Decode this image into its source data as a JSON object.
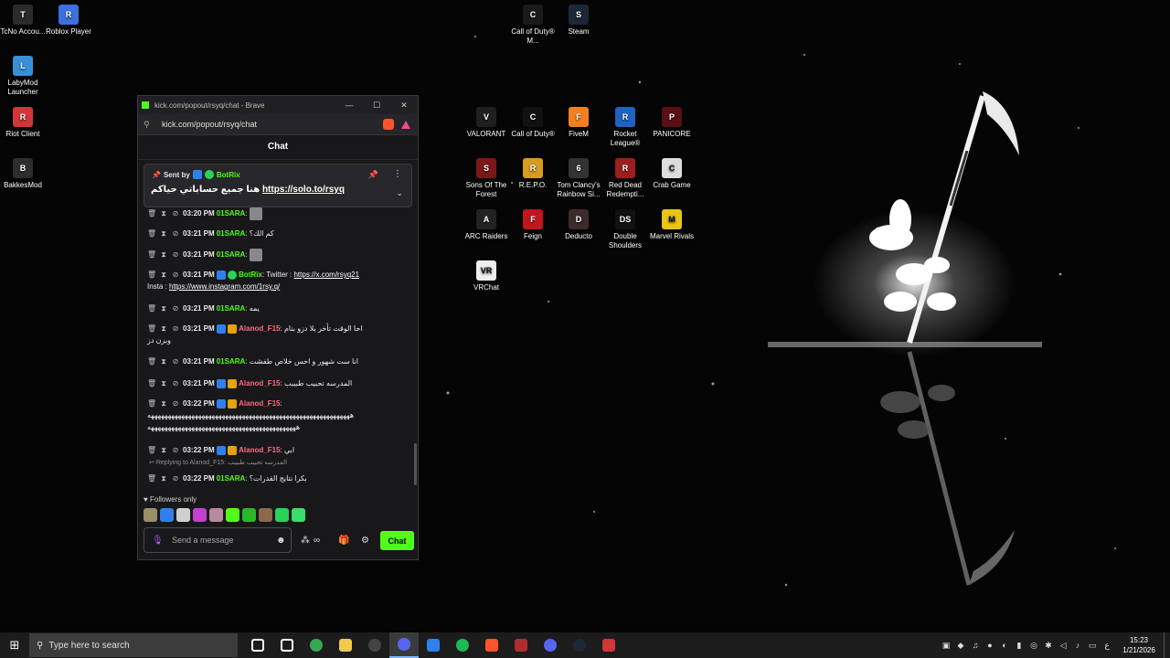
{
  "desktop_icons": [
    {
      "label": "TcNo Accou...",
      "color": "#2b2b2b",
      "glyph": "T"
    },
    {
      "label": "Roblox Player",
      "color": "#3c6fe0",
      "glyph": "R"
    },
    {
      "label": "LabyMod Launcher",
      "color": "#3a8fd9",
      "glyph": "L"
    },
    {
      "label": "Riot Client",
      "color": "#d13639",
      "glyph": "R"
    },
    {
      "label": "BakkesMod",
      "color": "#2d2d2d",
      "glyph": "B"
    },
    {
      "label": "Call of Duty® M...",
      "color": "#1a1a1a",
      "glyph": "C"
    },
    {
      "label": "Steam",
      "color": "#1b2838",
      "glyph": "S"
    },
    {
      "label": "VALORANT",
      "color": "#1f1f1f",
      "glyph": "V"
    },
    {
      "label": "Call of Duty®",
      "color": "#111",
      "glyph": "C"
    },
    {
      "label": "FiveM",
      "color": "#f37f20",
      "glyph": "F"
    },
    {
      "label": "Rocket League®",
      "color": "#1e62c4",
      "glyph": "R"
    },
    {
      "label": "PANICORE",
      "color": "#5a0f14",
      "glyph": "P"
    },
    {
      "label": "Sons Of The Forest",
      "color": "#7a1818",
      "glyph": "S"
    },
    {
      "label": "R.E.P.O.",
      "color": "#d69c20",
      "glyph": "R"
    },
    {
      "label": "Tom Clancy's Rainbow Si...",
      "color": "#333",
      "glyph": "6"
    },
    {
      "label": "Red Dead Redempti...",
      "color": "#9c1e1e",
      "glyph": "R"
    },
    {
      "label": "Crab Game",
      "color": "#ddd",
      "glyph": "C"
    },
    {
      "label": "ARC Raiders",
      "color": "#222",
      "glyph": "A"
    },
    {
      "label": "Feign",
      "color": "#c0161d",
      "glyph": "F"
    },
    {
      "label": "Deducto",
      "color": "#3d2b2b",
      "glyph": "D"
    },
    {
      "label": "Double Shoulders",
      "color": "#111",
      "glyph": "DS"
    },
    {
      "label": "Marvel Rivals",
      "color": "#e8c419",
      "glyph": "M"
    },
    {
      "label": "VRChat",
      "color": "#eee",
      "glyph": "VR"
    }
  ],
  "browser": {
    "title": "kick.com/popout/rsyq/chat - Brave",
    "url": "kick.com/popout/rsyq/chat",
    "minimize": "—",
    "maximize": "☐",
    "close": "✕"
  },
  "chat": {
    "header": "Chat",
    "pinned": {
      "sent_by_label": "Sent by",
      "sender": "BotRix",
      "text": "هنا جميع حساباتي حياكم",
      "link": "https://solo.to/rsyq"
    },
    "messages": [
      {
        "time": "03:20 PM",
        "user": "01SARA",
        "user_color": "green",
        "text": "",
        "has_emote": true
      },
      {
        "time": "03:21 PM",
        "user": "01SARA",
        "user_color": "green",
        "text": "كم الك؟",
        "has_emote": false
      },
      {
        "time": "03:21 PM",
        "user": "01SARA",
        "user_color": "green",
        "text": "",
        "has_emote": true
      },
      {
        "time": "03:21 PM",
        "user": "BotRix",
        "user_color": "green",
        "text": "Twitter : ",
        "link1": "https://x.com/rsyq21",
        "text2": "Insta : ",
        "link2": "https://www.instagram.com/1rsy.q/"
      },
      {
        "time": "03:21 PM",
        "user": "01SARA",
        "user_color": "green",
        "text": "يمه",
        "has_emote": false
      },
      {
        "time": "03:21 PM",
        "user": "Alanod_F15",
        "user_color": "pink",
        "text": "احا الوقت تأخر يلا دزو بنام",
        "text_cont": "وبزن دز"
      },
      {
        "time": "03:21 PM",
        "user": "01SARA",
        "user_color": "green",
        "text": "انا ست شهور و احس خلاص طفشت"
      },
      {
        "time": "03:21 PM",
        "user": "Alanod_F15",
        "user_color": "pink",
        "text": "المدرسه تحبيب طبيبب"
      },
      {
        "time": "03:22 PM",
        "user": "Alanod_F15",
        "user_color": "pink",
        "text": "",
        "spam1": "ههههههههههههههههههههههههههههههههههههههههههههههههههههههههههههه",
        "spam2": "ههههههههههههههههههههههههههههههههههههههههههههه"
      },
      {
        "time": "03:22 PM",
        "user": "Alanod_F15",
        "user_color": "pink",
        "text": "ابي"
      },
      {
        "reply_label": "Replying to Alanod_F15:",
        "reply_text": "المدرسه تحبيب طبيبب",
        "time": "03:22 PM",
        "user": "01SARA",
        "user_color": "green",
        "text": "بكرا نتايج القدرات؟"
      }
    ],
    "followers_only": "Followers only",
    "input_placeholder": "Send a message",
    "send_label": "Chat"
  },
  "taskbar": {
    "search_placeholder": "Type here to search",
    "apps": [
      {
        "name": "task-view",
        "color": "#ffffff"
      },
      {
        "name": "steelseries",
        "color": "#ffffff"
      },
      {
        "name": "chrome",
        "color": "#34a853"
      },
      {
        "name": "file-explorer",
        "color": "#f2c94c"
      },
      {
        "name": "obs",
        "color": "#444444"
      },
      {
        "name": "discord-active",
        "color": "#5865f2"
      },
      {
        "name": "store",
        "color": "#2f80ed"
      },
      {
        "name": "spotify",
        "color": "#1db954"
      },
      {
        "name": "brave",
        "color": "#fb542b"
      },
      {
        "name": "game",
        "color": "#b12d2d"
      },
      {
        "name": "discord",
        "color": "#5865f2"
      },
      {
        "name": "steam",
        "color": "#1b2838"
      },
      {
        "name": "app",
        "color": "#d13639"
      }
    ],
    "lang": "ع",
    "time": "15:23",
    "date": "1/21/2026"
  }
}
